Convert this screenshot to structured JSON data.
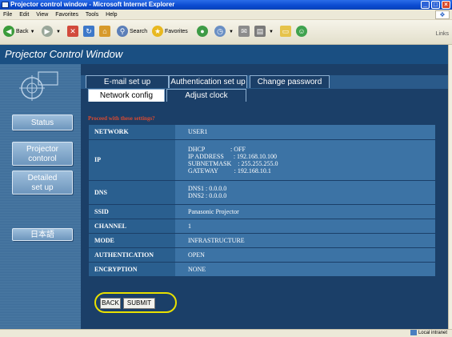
{
  "window": {
    "title": "Projector control window - Microsoft Internet Explorer"
  },
  "menu": [
    "File",
    "Edit",
    "View",
    "Favorites",
    "Tools",
    "Help"
  ],
  "toolbar": {
    "back": "Back",
    "search": "Search",
    "favorites": "Favorites",
    "links": "Links"
  },
  "header": {
    "title": "Projector Control Window"
  },
  "sidebar": {
    "status": "Status",
    "projector_line1": "Projector",
    "projector_line2": "contorol",
    "detailed_line1": "Detailed",
    "detailed_line2": "set up",
    "language": "日本語"
  },
  "tabs": {
    "email": "E-mail set up",
    "auth": "Authentication set up",
    "password": "Change password",
    "network": "Network config",
    "clock": "Adjust clock",
    "active": "Network config"
  },
  "warning": "Proceed with these settings?",
  "settings": [
    {
      "key": "NETWORK",
      "lines": [
        "USER1"
      ]
    },
    {
      "key": "IP",
      "lines": [
        "DHCP                : OFF",
        "IP ADDRESS      : 192.168.10.100",
        "SUBNETMASK    : 255.255.255.0",
        "GATEWAY          : 192.168.10.1"
      ]
    },
    {
      "key": "DNS",
      "lines": [
        "DNS1 : 0.0.0.0",
        "DNS2 : 0.0.0.0"
      ]
    },
    {
      "key": "SSID",
      "lines": [
        "Panasonic Projector"
      ]
    },
    {
      "key": "CHANNEL",
      "lines": [
        "1"
      ]
    },
    {
      "key": "MODE",
      "lines": [
        "INFRASTRUCTURE"
      ]
    },
    {
      "key": "AUTHENTICATION",
      "lines": [
        "OPEN"
      ]
    },
    {
      "key": "ENCRYPTION",
      "lines": [
        "NONE"
      ]
    }
  ],
  "buttons": {
    "back": "BACK",
    "submit": "SUBMIT"
  },
  "status": {
    "zone": "Local intranet"
  }
}
